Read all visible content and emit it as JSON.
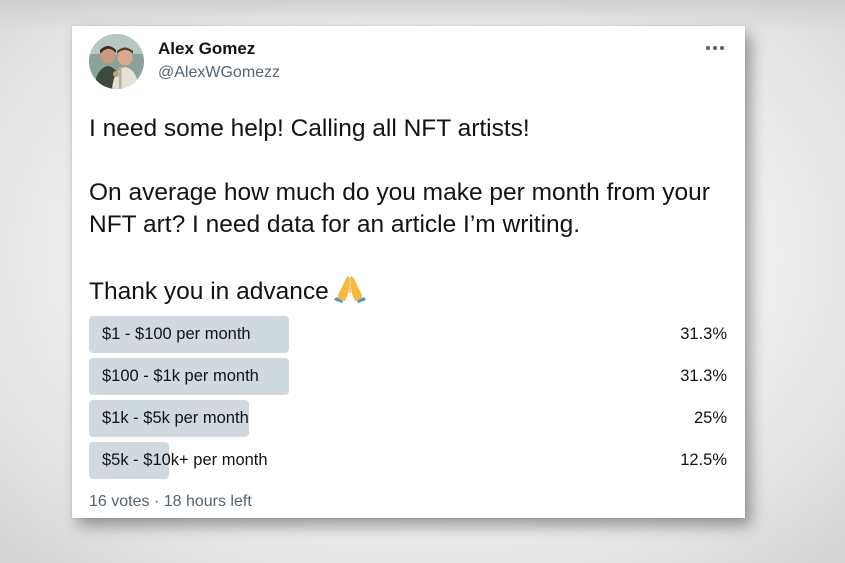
{
  "tweet": {
    "author_name": "Alex Gomez",
    "author_handle": "@AlexWGomezz",
    "more_icon": "more-horizontal-icon",
    "line1": "I need some help! Calling all NFT artists!",
    "line2": "On average how much do you make per month from your NFT art? I need data for an article I’m writing.",
    "line3": "Thank you in advance",
    "emoji": "folded-hands-icon"
  },
  "poll": {
    "options": [
      {
        "label": "$1 - $100 per month",
        "percent_text": "31.3%",
        "fraction": 0.313
      },
      {
        "label": "$100 - $1k per month",
        "percent_text": "31.3%",
        "fraction": 0.313
      },
      {
        "label": "$1k - $5k per month",
        "percent_text": "25%",
        "fraction": 0.25
      },
      {
        "label": "$5k - $10k+ per month",
        "percent_text": "12.5%",
        "fraction": 0.125
      }
    ],
    "votes": "16 votes",
    "separator": "·",
    "time_left": "18 hours left"
  },
  "colors": {
    "bar": "#cfd9de",
    "text": "#0f1419",
    "secondary": "#536471"
  }
}
